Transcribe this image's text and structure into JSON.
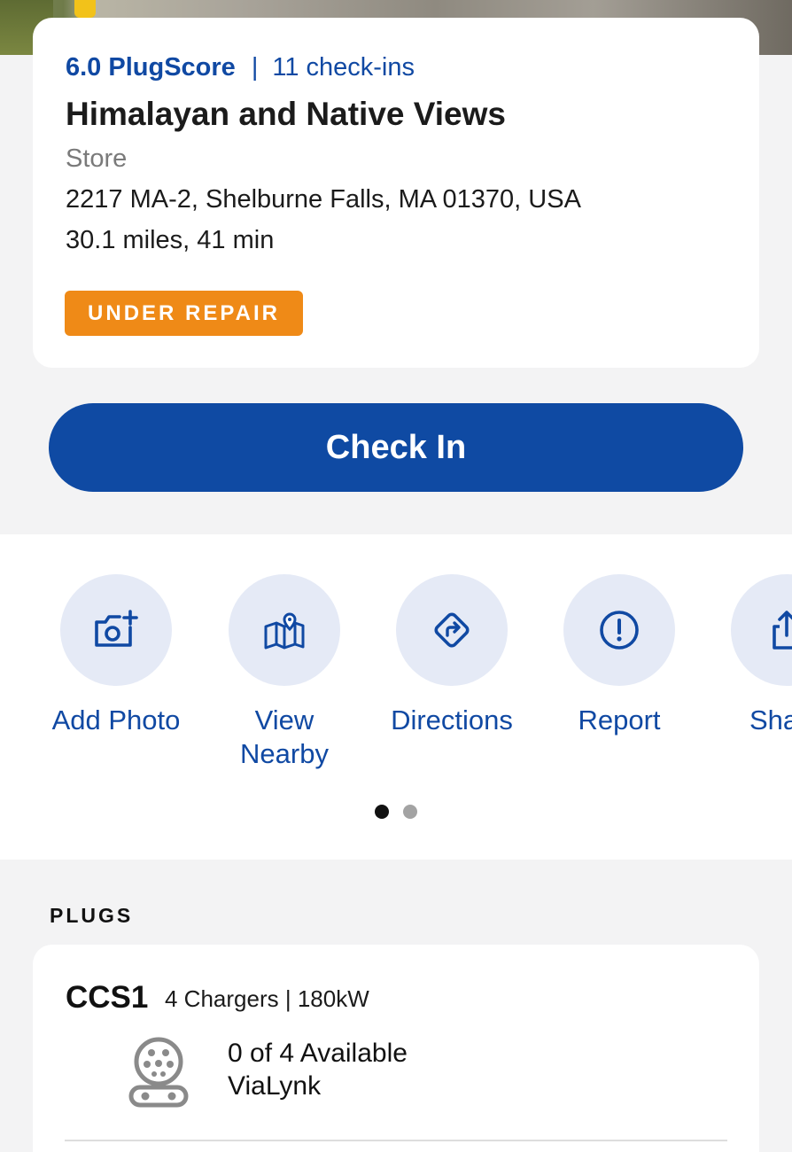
{
  "station": {
    "plugscore": "6.0 PlugScore",
    "separator": "|",
    "checkins": "11 check-ins",
    "name": "Himalayan and Native Views",
    "category": "Store",
    "address": "2217 MA-2, Shelburne Falls, MA 01370, USA",
    "distance": "30.1 miles, 41 min",
    "status": "UNDER REPAIR"
  },
  "checkin_button": {
    "label": "Check In"
  },
  "actions": [
    {
      "label": "Add Photo",
      "icon": "add-photo-icon"
    },
    {
      "label": "View\nNearby",
      "icon": "map-pin-icon"
    },
    {
      "label": "Directions",
      "icon": "directions-icon"
    },
    {
      "label": "Report",
      "icon": "report-icon"
    },
    {
      "label": "Sha",
      "icon": "share-icon"
    }
  ],
  "pagination": {
    "current_page": 1,
    "total_pages": 2
  },
  "plugs": {
    "heading": "PLUGS",
    "items": [
      {
        "name": "CCS1",
        "specs": "4 Chargers | 180kW",
        "availability": "0 of 4 Available",
        "network": "ViaLynk",
        "icon": "ccs1-connector-icon"
      }
    ]
  },
  "colors": {
    "accent": "#0f4aa3",
    "link": "#1049a3",
    "status_badge": "#ef8a17",
    "action_circle": "#e5eaf6",
    "background": "#f3f3f4"
  }
}
